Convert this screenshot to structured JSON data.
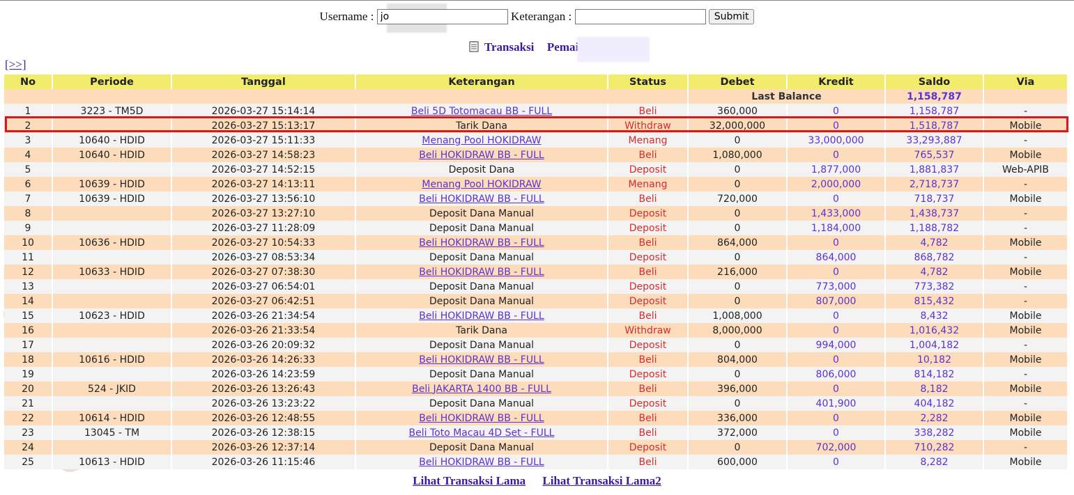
{
  "form": {
    "username_label": "Username :",
    "username_value": "jo",
    "keterangan_label": "Keterangan :",
    "keterangan_value": "",
    "submit_label": "Submit"
  },
  "heading": {
    "title": "Transaksi",
    "player_label": "Pemain : jo"
  },
  "nav_link": "[>>]",
  "columns": [
    "No",
    "Periode",
    "Tanggal",
    "Keterangan",
    "Status",
    "Debet",
    "Kredit",
    "Saldo",
    "Via"
  ],
  "last_balance": {
    "label": "Last Balance",
    "value": "1,158,787"
  },
  "rows": [
    {
      "no": "1",
      "periode": "3223 - TM5D",
      "tanggal": "2026-03-27 15:14:14",
      "ket": "Beli 5D Totomacau BB - FULL",
      "link": true,
      "status": "Beli",
      "debet": "360,000",
      "kredit": "0",
      "saldo": "1,158,787",
      "via": "-"
    },
    {
      "no": "2",
      "periode": "",
      "tanggal": "2026-03-27 15:13:17",
      "ket": "Tarik Dana",
      "link": false,
      "status": "Withdraw",
      "debet": "32,000,000",
      "kredit": "0",
      "saldo": "1,518,787",
      "via": "Mobile"
    },
    {
      "no": "3",
      "periode": "10640 - HDID",
      "tanggal": "2026-03-27 15:11:33",
      "ket": "Menang Pool HOKIDRAW",
      "link": true,
      "status": "Menang",
      "debet": "0",
      "kredit": "33,000,000",
      "saldo": "33,293,887",
      "via": "-"
    },
    {
      "no": "4",
      "periode": "10640 - HDID",
      "tanggal": "2026-03-27 14:58:23",
      "ket": "Beli HOKIDRAW BB - FULL",
      "link": true,
      "status": "Beli",
      "debet": "1,080,000",
      "kredit": "0",
      "saldo": "765,537",
      "via": "Mobile"
    },
    {
      "no": "5",
      "periode": "",
      "tanggal": "2026-03-27 14:52:15",
      "ket": "Deposit Dana",
      "link": false,
      "status": "Deposit",
      "debet": "0",
      "kredit": "1,877,000",
      "saldo": "1,881,837",
      "via": "Web-APIB"
    },
    {
      "no": "6",
      "periode": "10639 - HDID",
      "tanggal": "2026-03-27 14:13:11",
      "ket": "Menang Pool HOKIDRAW",
      "link": true,
      "status": "Menang",
      "debet": "0",
      "kredit": "2,000,000",
      "saldo": "2,718,737",
      "via": "-"
    },
    {
      "no": "7",
      "periode": "10639 - HDID",
      "tanggal": "2026-03-27 13:56:10",
      "ket": "Beli HOKIDRAW BB - FULL",
      "link": true,
      "status": "Beli",
      "debet": "720,000",
      "kredit": "0",
      "saldo": "718,737",
      "via": "Mobile"
    },
    {
      "no": "8",
      "periode": "",
      "tanggal": "2026-03-27 13:27:10",
      "ket": "Deposit Dana Manual",
      "link": false,
      "status": "Deposit",
      "debet": "0",
      "kredit": "1,433,000",
      "saldo": "1,438,737",
      "via": "-"
    },
    {
      "no": "9",
      "periode": "",
      "tanggal": "2026-03-27 11:28:09",
      "ket": "Deposit Dana Manual",
      "link": false,
      "status": "Deposit",
      "debet": "0",
      "kredit": "1,184,000",
      "saldo": "1,188,782",
      "via": "-"
    },
    {
      "no": "10",
      "periode": "10636 - HDID",
      "tanggal": "2026-03-27 10:54:33",
      "ket": "Beli HOKIDRAW BB - FULL",
      "link": true,
      "status": "Beli",
      "debet": "864,000",
      "kredit": "0",
      "saldo": "4,782",
      "via": "Mobile"
    },
    {
      "no": "11",
      "periode": "",
      "tanggal": "2026-03-27 08:53:34",
      "ket": "Deposit Dana Manual",
      "link": false,
      "status": "Deposit",
      "debet": "0",
      "kredit": "864,000",
      "saldo": "868,782",
      "via": "-"
    },
    {
      "no": "12",
      "periode": "10633 - HDID",
      "tanggal": "2026-03-27 07:38:30",
      "ket": "Beli HOKIDRAW BB - FULL",
      "link": true,
      "status": "Beli",
      "debet": "216,000",
      "kredit": "0",
      "saldo": "4,782",
      "via": "Mobile"
    },
    {
      "no": "13",
      "periode": "",
      "tanggal": "2026-03-27 06:54:01",
      "ket": "Deposit Dana Manual",
      "link": false,
      "status": "Deposit",
      "debet": "0",
      "kredit": "773,000",
      "saldo": "773,382",
      "via": "-"
    },
    {
      "no": "14",
      "periode": "",
      "tanggal": "2026-03-27 06:42:51",
      "ket": "Deposit Dana Manual",
      "link": false,
      "status": "Deposit",
      "debet": "0",
      "kredit": "807,000",
      "saldo": "815,432",
      "via": "-"
    },
    {
      "no": "15",
      "periode": "10623 - HDID",
      "tanggal": "2026-03-26 21:34:54",
      "ket": "Beli HOKIDRAW BB - FULL",
      "link": true,
      "status": "Beli",
      "debet": "1,008,000",
      "kredit": "0",
      "saldo": "8,432",
      "via": "Mobile"
    },
    {
      "no": "16",
      "periode": "",
      "tanggal": "2026-03-26 21:33:54",
      "ket": "Tarik Dana",
      "link": false,
      "status": "Withdraw",
      "debet": "8,000,000",
      "kredit": "0",
      "saldo": "1,016,432",
      "via": "Mobile"
    },
    {
      "no": "17",
      "periode": "",
      "tanggal": "2026-03-26 20:09:32",
      "ket": "Deposit Dana Manual",
      "link": false,
      "status": "Deposit",
      "debet": "0",
      "kredit": "994,000",
      "saldo": "1,004,182",
      "via": "-"
    },
    {
      "no": "18",
      "periode": "10616 - HDID",
      "tanggal": "2026-03-26 14:26:33",
      "ket": "Beli HOKIDRAW BB - FULL",
      "link": true,
      "status": "Beli",
      "debet": "804,000",
      "kredit": "0",
      "saldo": "10,182",
      "via": "Mobile"
    },
    {
      "no": "19",
      "periode": "",
      "tanggal": "2026-03-26 14:23:59",
      "ket": "Deposit Dana Manual",
      "link": false,
      "status": "Deposit",
      "debet": "0",
      "kredit": "806,000",
      "saldo": "814,182",
      "via": "-"
    },
    {
      "no": "20",
      "periode": "524 - JKID",
      "tanggal": "2026-03-26 13:26:43",
      "ket": "Beli JAKARTA 1400 BB - FULL",
      "link": true,
      "status": "Beli",
      "debet": "396,000",
      "kredit": "0",
      "saldo": "8,182",
      "via": "Mobile"
    },
    {
      "no": "21",
      "periode": "",
      "tanggal": "2026-03-26 13:23:22",
      "ket": "Deposit Dana Manual",
      "link": false,
      "status": "Deposit",
      "debet": "0",
      "kredit": "401,900",
      "saldo": "404,182",
      "via": "-"
    },
    {
      "no": "22",
      "periode": "10614 - HDID",
      "tanggal": "2026-03-26 12:48:55",
      "ket": "Beli HOKIDRAW BB - FULL",
      "link": true,
      "status": "Beli",
      "debet": "336,000",
      "kredit": "0",
      "saldo": "2,282",
      "via": "Mobile"
    },
    {
      "no": "23",
      "periode": "13045 - TM",
      "tanggal": "2026-03-26 12:38:15",
      "ket": "Beli Toto Macau 4D Set - FULL",
      "link": true,
      "status": "Beli",
      "debet": "372,000",
      "kredit": "0",
      "saldo": "338,282",
      "via": "Mobile"
    },
    {
      "no": "24",
      "periode": "",
      "tanggal": "2026-03-26 12:37:14",
      "ket": "Deposit Dana Manual",
      "link": false,
      "status": "Deposit",
      "debet": "0",
      "kredit": "702,000",
      "saldo": "710,282",
      "via": "-"
    },
    {
      "no": "25",
      "periode": "10613 - HDID",
      "tanggal": "2026-03-26 11:15:46",
      "ket": "Beli HOKIDRAW BB - FULL",
      "link": true,
      "status": "Beli",
      "debet": "600,000",
      "kredit": "0",
      "saldo": "8,282",
      "via": "Mobile"
    }
  ],
  "footer": {
    "link1": "Lihat Transaksi Lama",
    "link2": "Lihat Transaksi Lama2"
  },
  "colors": {
    "header_bg": "#f1ec6b",
    "row_even": "#fcdcba",
    "row_odd": "#f3f3f3",
    "status_red": "#d42d2d",
    "link_purple": "#5b32d0",
    "highlight_red": "#e0141a"
  }
}
